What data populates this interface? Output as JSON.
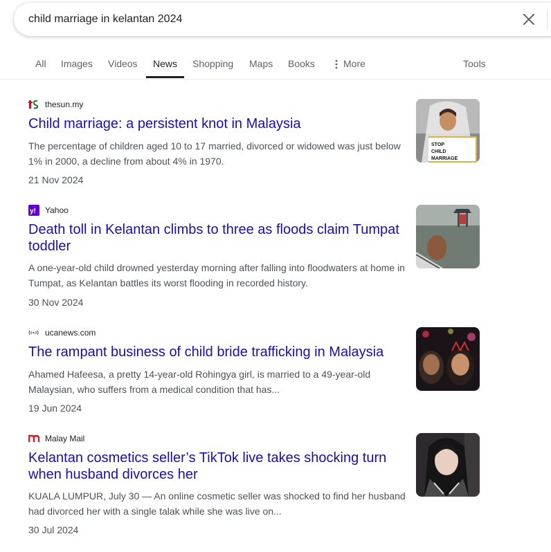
{
  "search": {
    "query": "child marriage in kelantan 2024"
  },
  "tabs": [
    {
      "label": "All"
    },
    {
      "label": "Images"
    },
    {
      "label": "Videos"
    },
    {
      "label": "News"
    },
    {
      "label": "Shopping"
    },
    {
      "label": "Maps"
    },
    {
      "label": "Books"
    },
    {
      "label": "More"
    }
  ],
  "tools_label": "Tools",
  "results": [
    {
      "source": "thesun.my",
      "title": "Child marriage: a persistent knot in Malaysia",
      "snippet": "The percentage of children aged 10 to 17 married, divorced or widowed was just below 1% in 2000, a decline from about 4% in 1970.",
      "date": "21 Nov 2024",
      "thumb_sign": [
        "STOP",
        "CHILD",
        "MARRIAGE"
      ]
    },
    {
      "source": "Yahoo",
      "title": "Death toll in Kelantan climbs to three as floods claim Tumpat toddler",
      "snippet": "A one-year-old child drowned yesterday morning after falling into floodwaters at home in Tumpat, as Kelantan battles its worst flooding in recorded history.",
      "date": "30 Nov 2024"
    },
    {
      "source": "ucanews.com",
      "title": "The rampant business of child bride trafficking in Malaysia",
      "snippet": "Ahamed Hafeesa, a pretty 14-year-old Rohingya girl, is married to a 49-year-old Malaysian, who suffers from a medical condition that has...",
      "date": "19 Jun 2024"
    },
    {
      "source": "Malay Mail",
      "title": "Kelantan cosmetics seller’s TikTok live takes shocking turn when husband divorces her",
      "snippet": "KUALA LUMPUR, July 30 — An online cosmetic seller was shocked to find her husband had divorced her with a single talak while she was live on...",
      "date": "30 Jul 2024"
    }
  ]
}
